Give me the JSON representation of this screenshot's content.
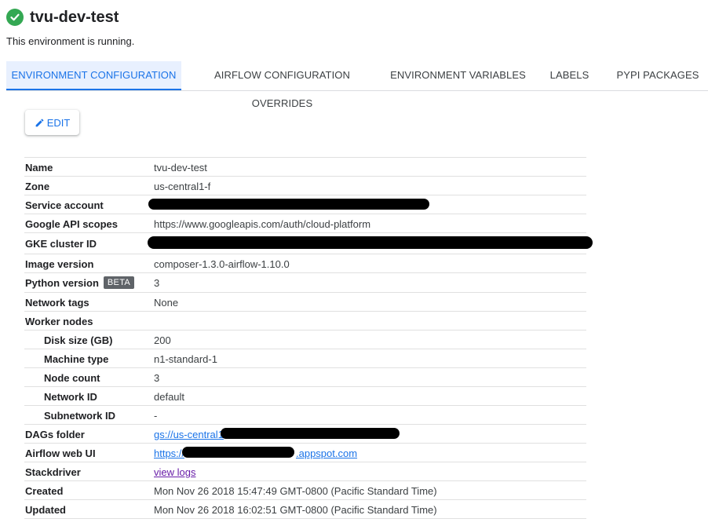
{
  "header": {
    "title": "tvu-dev-test",
    "status": "This environment is running."
  },
  "tabs": [
    {
      "label": "ENVIRONMENT CONFIGURATION",
      "active": true
    },
    {
      "label": "AIRFLOW CONFIGURATION OVERRIDES",
      "active": false
    },
    {
      "label": "ENVIRONMENT VARIABLES",
      "active": false
    },
    {
      "label": "LABELS",
      "active": false
    },
    {
      "label": "PYPI PACKAGES",
      "active": false
    }
  ],
  "toolbar": {
    "edit_label": "EDIT"
  },
  "config": {
    "name": {
      "label": "Name",
      "value": "tvu-dev-test"
    },
    "zone": {
      "label": "Zone",
      "value": "us-central1-f"
    },
    "service_account": {
      "label": "Service account",
      "value": ""
    },
    "api_scopes": {
      "label": "Google API scopes",
      "value": "https://www.googleapis.com/auth/cloud-platform"
    },
    "gke_cluster": {
      "label": "GKE cluster ID",
      "value": ""
    },
    "image_version": {
      "label": "Image version",
      "value": "composer-1.3.0-airflow-1.10.0"
    },
    "python_version": {
      "label": "Python version",
      "badge": "BETA",
      "value": "3"
    },
    "network_tags": {
      "label": "Network tags",
      "value": "None"
    },
    "worker_nodes": {
      "label": "Worker nodes"
    },
    "disk_size": {
      "label": "Disk size (GB)",
      "value": "200"
    },
    "machine_type": {
      "label": "Machine type",
      "value": "n1-standard-1"
    },
    "node_count": {
      "label": "Node count",
      "value": "3"
    },
    "network_id": {
      "label": "Network ID",
      "value": "default"
    },
    "subnetwork_id": {
      "label": "Subnetwork ID",
      "value": "-"
    },
    "dags_folder": {
      "label": "DAGs folder",
      "value": "gs://us-central1"
    },
    "airflow_ui": {
      "label": "Airflow web UI",
      "prefix": "https://",
      "suffix": ".appspot.com"
    },
    "stackdriver": {
      "label": "Stackdriver",
      "value": "view logs"
    },
    "created": {
      "label": "Created",
      "value": "Mon Nov 26 2018 15:47:49 GMT-0800 (Pacific Standard Time)"
    },
    "updated": {
      "label": "Updated",
      "value": "Mon Nov 26 2018 16:02:51 GMT-0800 (Pacific Standard Time)"
    }
  },
  "icons": {
    "status": "check-circle-icon",
    "edit": "pencil-icon"
  },
  "colors": {
    "accent": "#1a73e8",
    "success": "#34a853",
    "visited_link": "#681da8",
    "badge_bg": "#5f6368"
  }
}
